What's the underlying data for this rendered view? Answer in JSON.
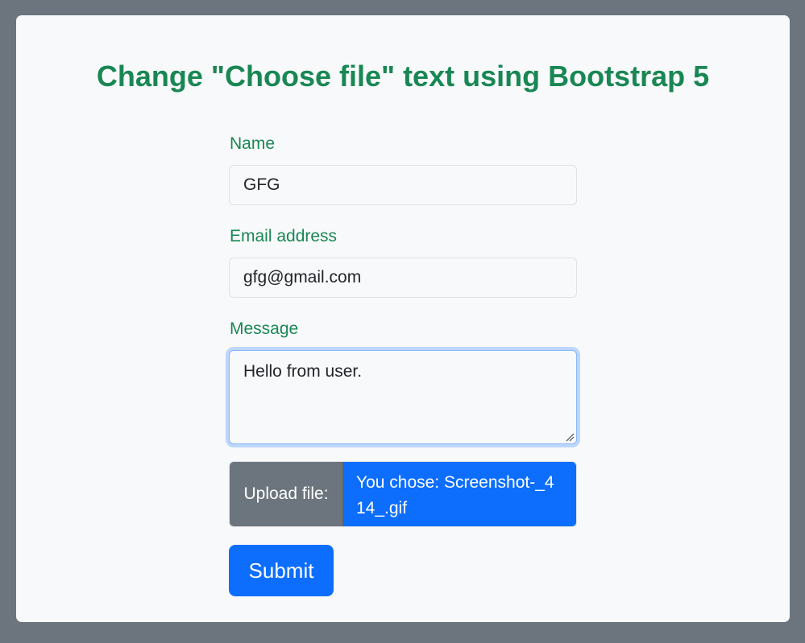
{
  "page": {
    "title": "Change \"Choose file\" text using Bootstrap 5"
  },
  "form": {
    "name": {
      "label": "Name",
      "value": "GFG"
    },
    "email": {
      "label": "Email address",
      "value": "gfg@gmail.com"
    },
    "message": {
      "label": "Message",
      "value": "Hello from user."
    },
    "file": {
      "label": "Upload file:",
      "chosen_text": "You chose: Screenshot-_414_.gif"
    },
    "submit_label": "Submit"
  },
  "colors": {
    "background": "#6c757d",
    "card": "#f8f9fa",
    "label_green": "#198754",
    "primary": "#0d6efd",
    "secondary": "#6c757d"
  }
}
